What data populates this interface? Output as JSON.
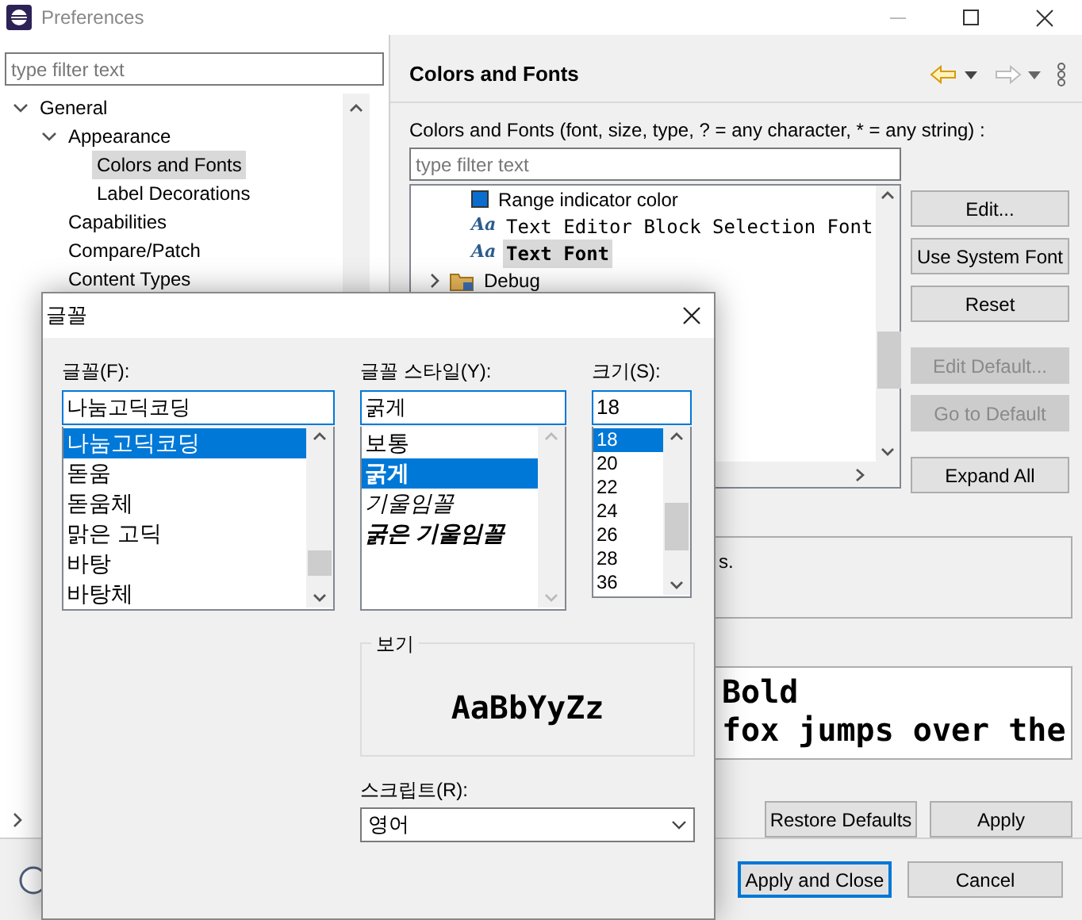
{
  "window": {
    "title": "Preferences"
  },
  "left": {
    "filter": {
      "placeholder": "type filter text"
    },
    "tree": [
      {
        "label": "General",
        "expanded": true,
        "selected": false,
        "children": [
          {
            "label": "Appearance",
            "expanded": true,
            "selected": false,
            "children": [
              {
                "label": "Colors and Fonts",
                "selected": true
              },
              {
                "label": "Label Decorations",
                "selected": false
              }
            ]
          },
          {
            "label": "Capabilities",
            "selected": false
          },
          {
            "label": "Compare/Patch",
            "selected": false
          },
          {
            "label": "Content Types",
            "selected": false
          }
        ]
      }
    ]
  },
  "right": {
    "title": "Colors and Fonts",
    "description": "Colors and Fonts (font, size, type, ? = any character, * = any string) :",
    "filter": {
      "placeholder": "type filter text"
    },
    "items": [
      {
        "kind": "color",
        "label": "Range indicator color",
        "color": "#0a6ed1",
        "selected": false
      },
      {
        "kind": "font",
        "icon": "Aa",
        "label": "Text Editor Block Selection Font",
        "selected": false
      },
      {
        "kind": "font",
        "icon": "Aa",
        "label": "Text Font",
        "selected": true
      },
      {
        "kind": "folder",
        "label": "Debug",
        "expanded": false,
        "selected": false
      }
    ],
    "buttons": [
      {
        "label": "Edit...",
        "disabled": false
      },
      {
        "label": "Use System Font",
        "disabled": false
      },
      {
        "label": "Reset",
        "disabled": false
      },
      {
        "label": "Edit Default...",
        "disabled": true
      },
      {
        "label": "Go to Default",
        "disabled": true
      },
      {
        "label": "Expand All",
        "disabled": false
      }
    ],
    "description_text": "s.",
    "preview_lines": [
      "Bold",
      "fox jumps over the"
    ],
    "page_buttons": [
      "Restore Defaults",
      "Apply"
    ]
  },
  "footer": {
    "buttons": [
      {
        "label": "Apply and Close",
        "default": true
      },
      {
        "label": "Cancel",
        "default": false
      }
    ]
  },
  "font_dialog": {
    "title": "글꼴",
    "font": {
      "label": "글꼴(F):",
      "value": "나눔고딕코딩",
      "items": [
        {
          "label": "나눔고딕코딩",
          "selected": true
        },
        {
          "label": "돋움",
          "selected": false
        },
        {
          "label": "돋움체",
          "selected": false
        },
        {
          "label": "맑은 고딕",
          "selected": false
        },
        {
          "label": "바탕",
          "selected": false
        },
        {
          "label": "바탕체",
          "selected": false
        }
      ]
    },
    "style": {
      "label": "글꼴 스타일(Y):",
      "value": "굵게",
      "items": [
        {
          "label": "보통",
          "kind": "regular",
          "selected": false
        },
        {
          "label": "굵게",
          "kind": "bold",
          "selected": true
        },
        {
          "label": "기울임꼴",
          "kind": "italic",
          "selected": false
        },
        {
          "label": "굵은 기울임꼴",
          "kind": "bold_italic",
          "selected": false
        }
      ]
    },
    "size": {
      "label": "크기(S):",
      "value": "18",
      "items": [
        {
          "label": "18",
          "selected": true
        },
        {
          "label": "20",
          "selected": false
        },
        {
          "label": "22",
          "selected": false
        },
        {
          "label": "24",
          "selected": false
        },
        {
          "label": "26",
          "selected": false
        },
        {
          "label": "28",
          "selected": false
        },
        {
          "label": "36",
          "selected": false
        }
      ]
    },
    "preview": {
      "legend": "보기",
      "sample": "AaBbYyZz"
    },
    "script": {
      "label": "스크립트(R):",
      "value": "영어"
    }
  }
}
